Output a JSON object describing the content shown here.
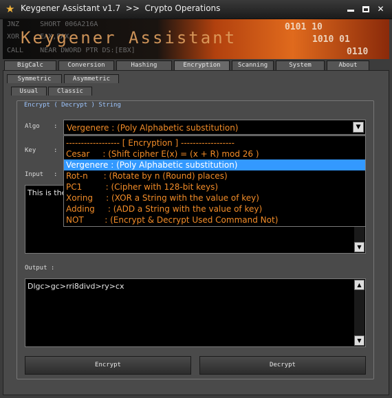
{
  "window": {
    "title": "Keygener Assistant v1.7  >>  Crypto Operations",
    "controls": [
      "minimize",
      "maximize",
      "close"
    ]
  },
  "banner": {
    "asm_lines": [
      "JNZ     SHORT 006A216A",
      "XOR     EAX,EAX",
      "CALL    NEAR DWORD PTR DS:[EBX]"
    ],
    "brand": "Keygener Assistant"
  },
  "main_tabs": [
    "BigCalc",
    "Conversion",
    "Hashing",
    "Encryption",
    "Scanning",
    "System",
    "About"
  ],
  "main_tabs_active": "Encryption",
  "sub_tabs": [
    "Symmetric",
    "Asymmetric"
  ],
  "cipher_tabs": [
    "Usual",
    "Classic"
  ],
  "group": {
    "legend": "Encrypt ( Decrypt ) String",
    "algo_label": "Algo",
    "key_label": "Key",
    "input_label": "Input",
    "output_label": "Output :",
    "colon": ":"
  },
  "algo": {
    "selected": "Vergenere : (Poly Alphabetic substitution)",
    "options": [
      "------------------ [ Encryption ] ------------------",
      "Cesar     : (Shift cipher E(x) = (x + R) mod 26 )",
      "Vergenere : (Poly Alphabetic substitution)",
      "Rot-n      : (Rotate by n (Round) places)",
      "PC1         : (Cipher with 128-bit keys)",
      "Xoring     : (XOR a String with the value of key)",
      "Adding     : (ADD a String with the value of key)",
      "NOT        : (Encrypt & Decrypt Used Command Not)"
    ],
    "highlighted_index": 2
  },
  "input": {
    "text": "This is the"
  },
  "output": {
    "text": "Dlgc>gc>rri8divd>ry>cx"
  },
  "buttons": {
    "encrypt": "Encrypt",
    "decrypt": "Decrypt"
  },
  "icons": {
    "app": "star-icon",
    "dropdown": "chevron-down-icon",
    "scroll_up": "arrow-up-icon",
    "scroll_down": "arrow-down-icon"
  },
  "colors": {
    "accent_text": "#f28c28",
    "legend": "#9ec6ff",
    "selection": "#3399ff"
  }
}
